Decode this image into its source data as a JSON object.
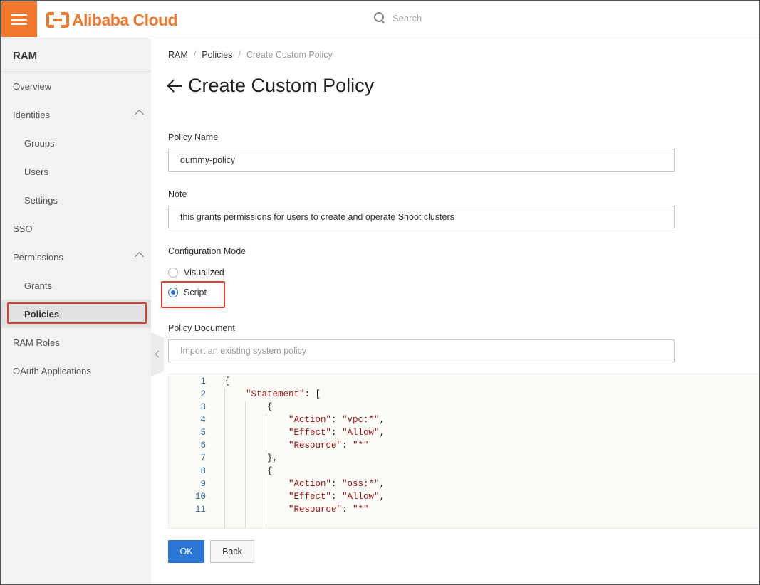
{
  "header": {
    "logo_text": "Alibaba Cloud",
    "search_placeholder": "Search"
  },
  "sidebar": {
    "title": "RAM",
    "items": [
      {
        "label": "Overview"
      },
      {
        "label": "Identities",
        "expanded": true
      },
      {
        "label": "Groups"
      },
      {
        "label": "Users"
      },
      {
        "label": "Settings"
      },
      {
        "label": "SSO"
      },
      {
        "label": "Permissions",
        "expanded": true
      },
      {
        "label": "Grants"
      },
      {
        "label": "Policies",
        "active": true
      },
      {
        "label": "RAM Roles"
      },
      {
        "label": "OAuth Applications"
      }
    ]
  },
  "breadcrumb": [
    "RAM",
    "Policies",
    "Create Custom Policy"
  ],
  "page_title": "Create Custom Policy",
  "form": {
    "policy_name_label": "Policy Name",
    "policy_name_value": "dummy-policy",
    "note_label": "Note",
    "note_value": "this grants permissions for users to create and operate Shoot clusters",
    "config_mode_label": "Configuration Mode",
    "config_options": [
      {
        "label": "Visualized",
        "selected": false
      },
      {
        "label": "Script",
        "selected": true
      }
    ],
    "policy_doc_label": "Policy Document",
    "import_placeholder": "Import an existing system policy"
  },
  "editor": {
    "lines": [
      {
        "n": "1",
        "text": "{"
      },
      {
        "n": "2",
        "text": "    \"Statement\": ["
      },
      {
        "n": "3",
        "text": "        {"
      },
      {
        "n": "4",
        "text": "            \"Action\": \"vpc:*\","
      },
      {
        "n": "5",
        "text": "            \"Effect\": \"Allow\","
      },
      {
        "n": "6",
        "text": "            \"Resource\": \"*\""
      },
      {
        "n": "7",
        "text": "        },"
      },
      {
        "n": "8",
        "text": "        {"
      },
      {
        "n": "9",
        "text": "            \"Action\": \"oss:*\","
      },
      {
        "n": "10",
        "text": "            \"Effect\": \"Allow\","
      },
      {
        "n": "11",
        "text": "            \"Resource\": \"*\""
      }
    ]
  },
  "buttons": {
    "ok": "OK",
    "back": "Back"
  },
  "colors": {
    "brand": "#f0772b",
    "primary": "#2a77d6",
    "highlight": "#e0412b"
  }
}
